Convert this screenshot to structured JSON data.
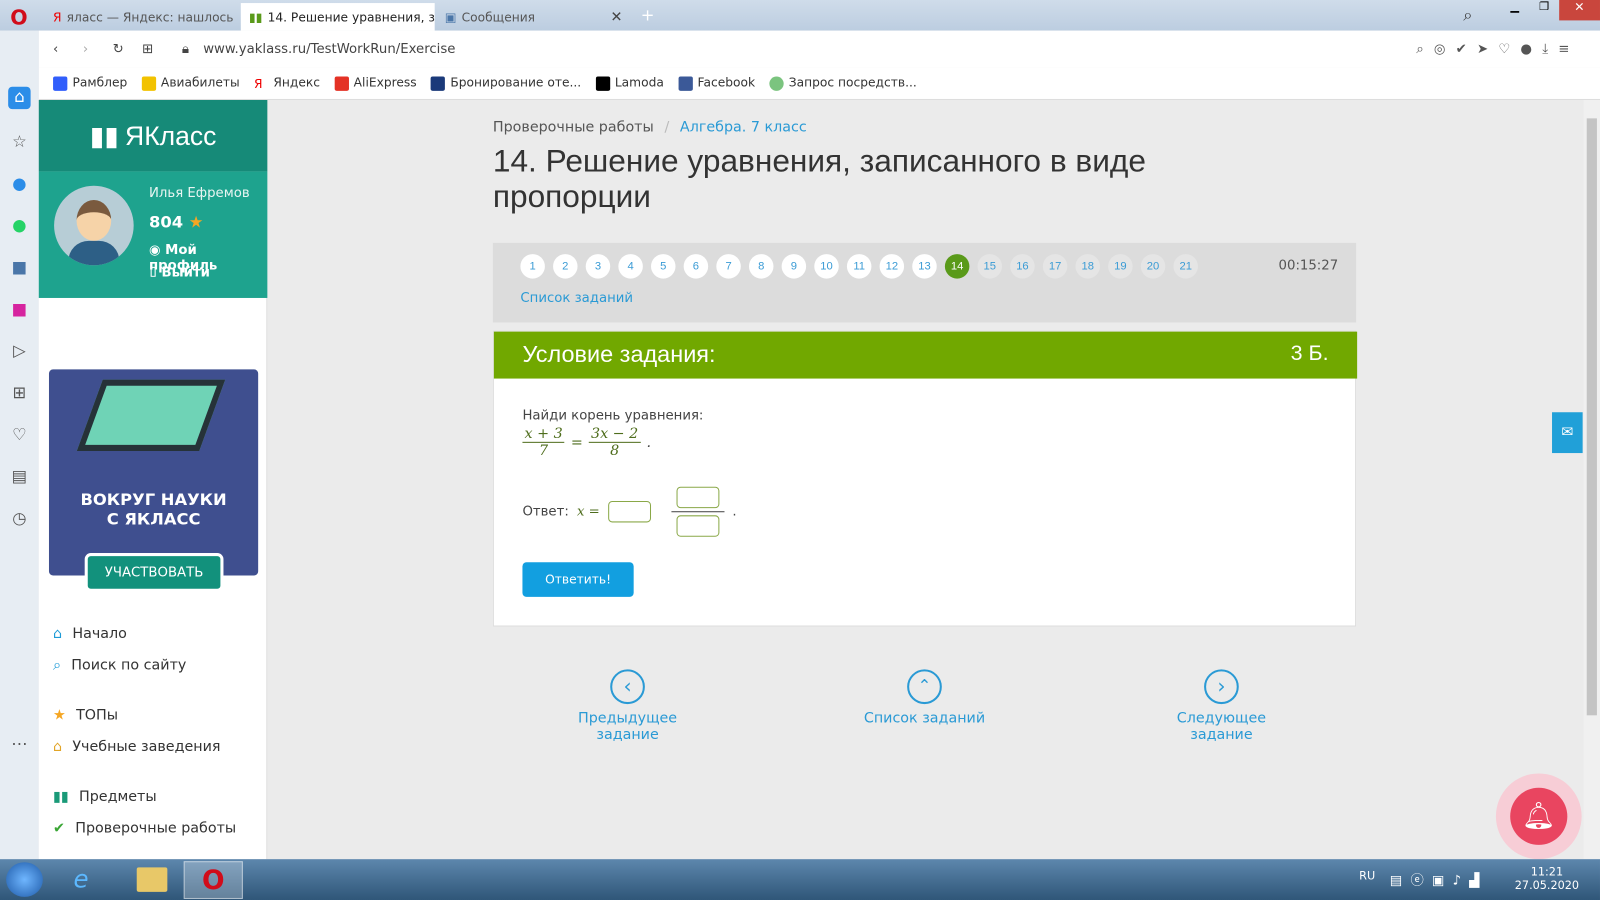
{
  "browser": {
    "tabs": [
      {
        "label": "яласс — Яндекс: нашлось"
      },
      {
        "label": "14. Решение уравнения, з"
      },
      {
        "label": "Сообщения"
      }
    ],
    "url": "www.yaklass.ru/TestWorkRun/Exercise",
    "bookmarks": [
      "Рамблер",
      "Авиабилеты",
      "Яндекс",
      "AliExpress",
      "Бронирование оте...",
      "Lamoda",
      "Facebook",
      "Запрос посредств..."
    ]
  },
  "sidebar": {
    "logo": "ЯКласс",
    "user_name": "Илья Ефремов",
    "points": "804",
    "profile": "Мой профиль",
    "logout": "Выйти",
    "banner_title": "ВОКРУГ НАУКИ С ЯКЛАСС",
    "banner_button": "УЧАСТВОВАТЬ",
    "nav": [
      "Начало",
      "Поиск по сайту",
      "ТОПы",
      "Учебные заведения",
      "Предметы",
      "Проверочные работы"
    ]
  },
  "breadcrumb": [
    "Проверочные работы",
    "Алгебра. 7 класс"
  ],
  "title": "14. Решение уравнения, записанного в виде пропорции",
  "tasks": {
    "numbers": [
      "1",
      "2",
      "3",
      "4",
      "5",
      "6",
      "7",
      "8",
      "9",
      "10",
      "11",
      "12",
      "13",
      "14",
      "15",
      "16",
      "17",
      "18",
      "19",
      "20",
      "21"
    ],
    "current": "14",
    "timer": "00:15:27",
    "list_link": "Список заданий"
  },
  "task": {
    "header": "Условие задания:",
    "points": "3 Б.",
    "prompt": "Найди корень уравнения:",
    "eq": {
      "n1": "x + 3",
      "d1": "7",
      "n2": "3x − 2",
      "d2": "8",
      "eq": "="
    },
    "answer_label": "Ответ:",
    "answer_var": "x =",
    "submit": "Ответить!"
  },
  "footer_nav": {
    "prev": "Предыдущее задание",
    "list": "Список заданий",
    "next": "Следующее задание"
  },
  "system": {
    "lang": "RU",
    "time": "11:21",
    "date": "27.05.2020"
  }
}
